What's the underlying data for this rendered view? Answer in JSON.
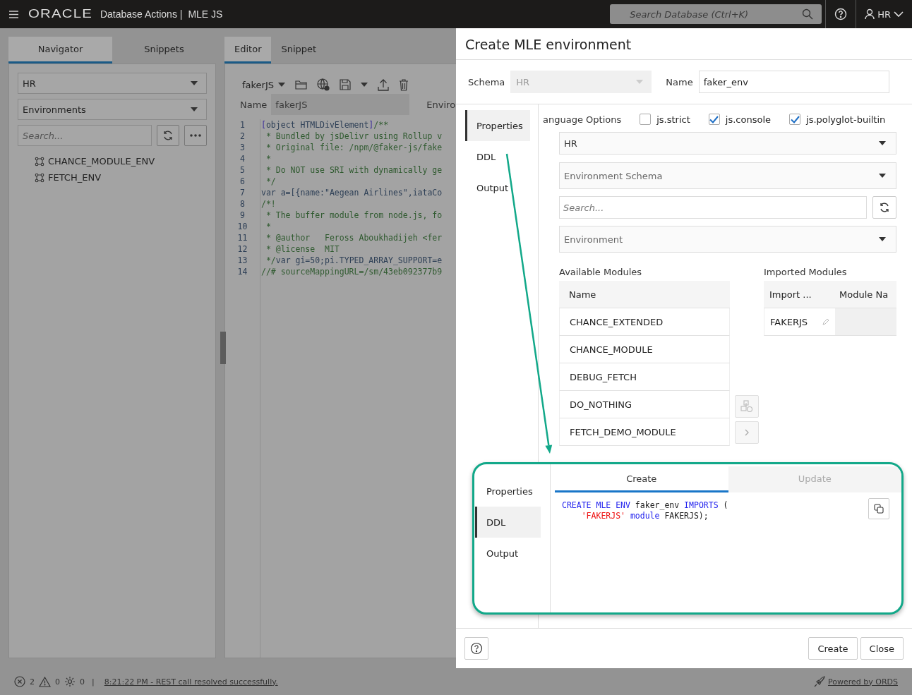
{
  "topbar": {
    "brand": "ORACLE",
    "product": "Database Actions |",
    "page": "MLE JS",
    "search": {
      "placeholder": "Search Database (Ctrl+K)"
    },
    "user": "HR"
  },
  "navigator": {
    "tabs": [
      {
        "label": "Navigator",
        "selected": true
      },
      {
        "label": "Snippets",
        "selected": false
      }
    ],
    "schema": "HR",
    "object_type": "Environments",
    "search": {
      "placeholder": "Search..."
    },
    "items": [
      "CHANCE_MODULE_ENV",
      "FETCH_ENV"
    ]
  },
  "editor": {
    "tabs": [
      {
        "label": "Editor",
        "selected": true
      },
      {
        "label": "Snippet",
        "selected": false
      }
    ],
    "module": "fakerJS",
    "name_label": "Name",
    "name_value": "fakerJS",
    "environment_label": "Enviro",
    "lines": [
      {
        "number": "1",
        "tokens": [
          {
            "text": "[",
            "kind": "bracket"
          },
          {
            "text": "object HTMLDivElement",
            "kind": "plain"
          },
          {
            "text": "]",
            "kind": "bracket"
          },
          {
            "text": "/**",
            "kind": "comment"
          }
        ]
      },
      {
        "number": "2",
        "tokens": [
          {
            "text": " * Bundled by jsDelivr using Rollup v",
            "kind": "comment"
          }
        ]
      },
      {
        "number": "3",
        "tokens": [
          {
            "text": " * Original file: /npm/@faker-js/fake",
            "kind": "comment"
          }
        ]
      },
      {
        "number": "4",
        "tokens": [
          {
            "text": " *",
            "kind": "comment"
          }
        ]
      },
      {
        "number": "5",
        "tokens": [
          {
            "text": " * Do NOT use SRI with dynamically ge",
            "kind": "comment"
          }
        ]
      },
      {
        "number": "6",
        "tokens": [
          {
            "text": " */",
            "kind": "comment"
          }
        ]
      },
      {
        "number": "7",
        "tokens": [
          {
            "text": "var a=[{name:\"Aegean Airlines\",iataCo",
            "kind": "plain"
          }
        ]
      },
      {
        "number": "8",
        "tokens": [
          {
            "text": "/*!",
            "kind": "comment"
          }
        ]
      },
      {
        "number": "9",
        "tokens": [
          {
            "text": " * The buffer module from node.js, fo",
            "kind": "comment"
          }
        ]
      },
      {
        "number": "10",
        "tokens": [
          {
            "text": " *",
            "kind": "comment"
          }
        ]
      },
      {
        "number": "11",
        "tokens": [
          {
            "text": " * @author   Feross Aboukhadijeh <fer",
            "kind": "comment"
          }
        ]
      },
      {
        "number": "12",
        "tokens": [
          {
            "text": " * @license  MIT",
            "kind": "comment"
          }
        ]
      },
      {
        "number": "13",
        "tokens": [
          {
            "text": " */",
            "kind": "comment"
          },
          {
            "text": "var gi=50;pi.TYPED_ARRAY_SUPPORT=e",
            "kind": "plain"
          }
        ]
      },
      {
        "number": "14",
        "tokens": [
          {
            "text": "//# sourceMappingURL=/sm/43eb092377b9",
            "kind": "comment"
          }
        ]
      }
    ]
  },
  "dialog": {
    "title": "Create MLE environment",
    "schema": {
      "label": "Schema",
      "value": "HR",
      "disabled": true
    },
    "name": {
      "label": "Name",
      "value": "faker_env"
    },
    "side_tabs": [
      {
        "label": "Properties",
        "selected": true
      },
      {
        "label": "DDL",
        "selected": false
      },
      {
        "label": "Output",
        "selected": false
      }
    ],
    "language_options": {
      "label": "anguage Options",
      "options": [
        {
          "label": "js.strict",
          "checked": false
        },
        {
          "label": "js.console",
          "checked": true
        },
        {
          "label": "js.polyglot-builtin",
          "checked": true
        }
      ]
    },
    "module_schema": "HR",
    "environment_schema": {
      "placeholder": "Environment Schema"
    },
    "search": {
      "placeholder": "Search..."
    },
    "environment": {
      "placeholder": "Environment"
    },
    "available": {
      "title": "Available Modules",
      "column": "Name",
      "rows": [
        "CHANCE_EXTENDED",
        "CHANCE_MODULE",
        "DEBUG_FETCH",
        "DO_NOTHING",
        "FETCH_DEMO_MODULE"
      ]
    },
    "imported": {
      "title": "Imported Modules",
      "columns": [
        "Import ...",
        "Module Na"
      ],
      "rows": [
        {
          "import_name": "FAKERJS"
        }
      ]
    },
    "footer": {
      "buttons": [
        "Create",
        "Close"
      ]
    }
  },
  "callout": {
    "side_tabs": [
      {
        "label": "Properties",
        "selected": false
      },
      {
        "label": "DDL",
        "selected": true
      },
      {
        "label": "Output",
        "selected": false
      }
    ],
    "tabs": [
      {
        "label": "Create",
        "selected": true
      },
      {
        "label": "Update",
        "selected": false
      }
    ],
    "ddl": [
      {
        "indent": false,
        "tokens": [
          {
            "text": "CREATE MLE ENV",
            "kind": "keyword"
          },
          {
            "text": " faker_env ",
            "kind": "plain"
          },
          {
            "text": "IMPORTS",
            "kind": "keyword"
          },
          {
            "text": " (",
            "kind": "plain"
          }
        ]
      },
      {
        "indent": true,
        "tokens": [
          {
            "text": "'FAKERJS'",
            "kind": "string"
          },
          {
            "text": " module",
            "kind": "keyword"
          },
          {
            "text": " FAKERJS);",
            "kind": "plain"
          }
        ]
      }
    ]
  },
  "status_bar": {
    "errors": "2",
    "warnings": "0",
    "tasks": "0",
    "separator": "|",
    "message": "8:21:22 PM - REST call resolved successfully.",
    "powered_by": "Powered by ORDS"
  }
}
